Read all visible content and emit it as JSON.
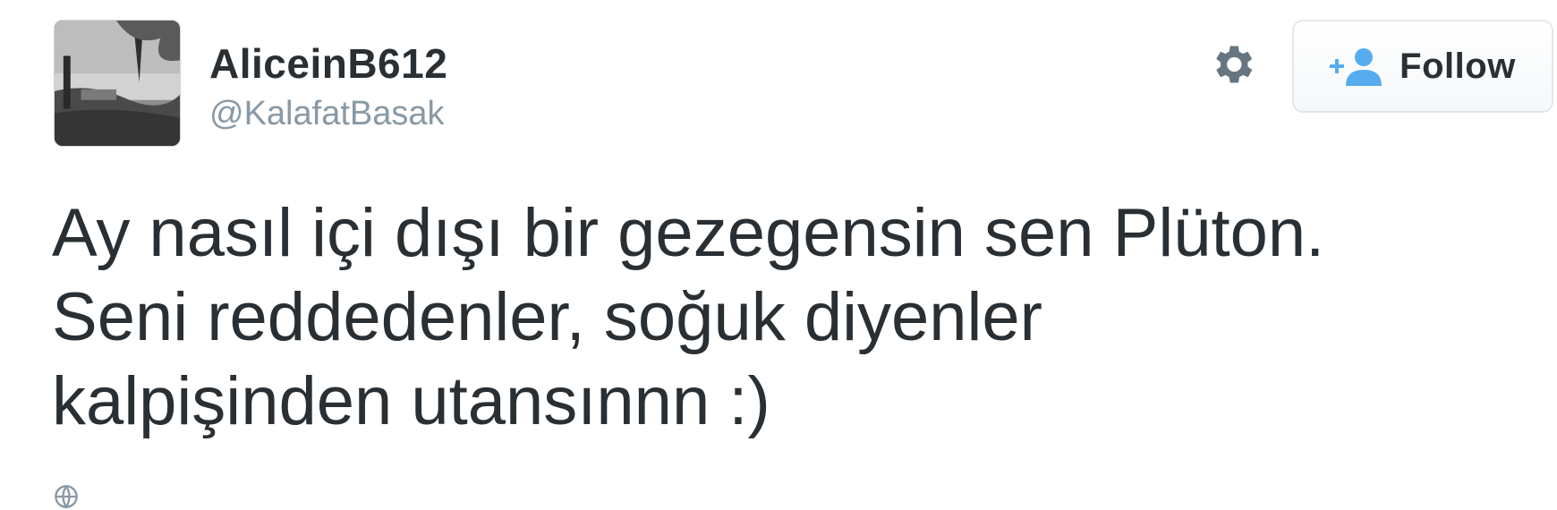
{
  "user": {
    "display_name": "AliceinB612",
    "handle": "@KalafatBasak"
  },
  "actions": {
    "settings_icon": "gear-icon",
    "follow_icon": "add-user-icon",
    "follow_label": "Follow"
  },
  "tweet": {
    "lines": [
      "Ay nasıl içi dışı bir gezegensin sen Plüton.",
      "Seni reddedenler, soğuk diyenler",
      "kalpişinden utansınnn :)"
    ]
  },
  "footer": {
    "icon": "globe-icon"
  },
  "colors": {
    "text": "#292f33",
    "muted": "#8899a6",
    "follow_icon": "#55acee",
    "gear": "#66757f",
    "button_border": "#e1e8ed"
  }
}
